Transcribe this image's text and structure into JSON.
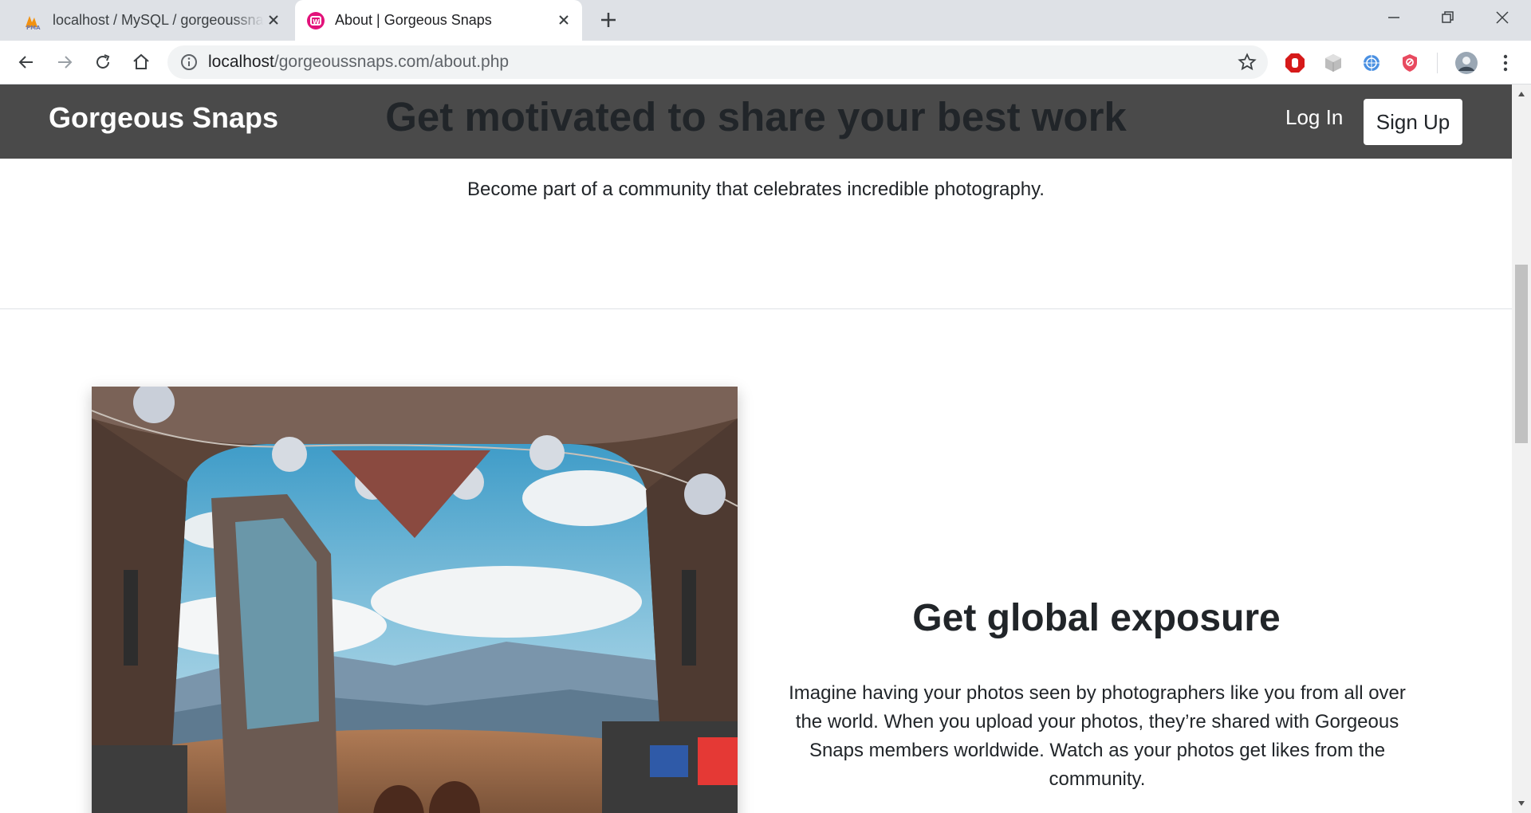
{
  "browser": {
    "tabs": [
      {
        "title": "localhost / MySQL / gorgeoussnaps",
        "favicon": "phpmyadmin-icon",
        "active": false
      },
      {
        "title": "About | Gorgeous Snaps",
        "favicon": "site-favicon-icon",
        "active": true
      }
    ],
    "url": {
      "host": "localhost",
      "path": "/gorgeoussnaps.com/about.php"
    }
  },
  "site": {
    "brand": "Gorgeous Snaps",
    "hero_title": "Get motivated to share your best work",
    "nav": {
      "login": "Log In",
      "signup": "Sign Up"
    },
    "subtitle": "Become part of a community that celebrates incredible photography.",
    "feature": {
      "title": "Get global exposure",
      "text": "Imagine having your photos seen by photographers like you from all over the world. When you upload your photos, they’re shared with Gorgeous Snaps members worldwide. Watch as your photos get likes from the community."
    }
  },
  "colors": {
    "nav_bg": "#4a4a4a",
    "tabstrip_bg": "#dee1e6",
    "text": "#212529"
  }
}
